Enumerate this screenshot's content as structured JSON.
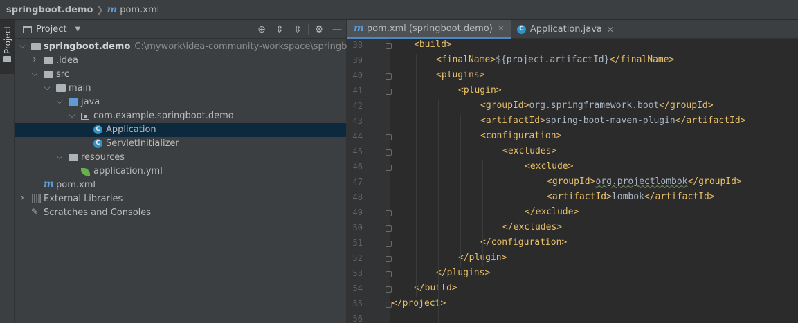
{
  "navbar": {
    "project": "springboot.demo",
    "file": "pom.xml"
  },
  "stripe": {
    "label": "Project"
  },
  "panel": {
    "title": "Project",
    "tree": [
      {
        "label": "springboot.demo",
        "path": "C:\\mywork\\idea-community-workspace\\springboot.demo",
        "depth": 0,
        "icon": "folder",
        "expanded": true,
        "bold": true
      },
      {
        "label": ".idea",
        "depth": 1,
        "icon": "folder",
        "expanded": false
      },
      {
        "label": "src",
        "depth": 1,
        "icon": "folder",
        "expanded": true
      },
      {
        "label": "main",
        "depth": 2,
        "icon": "folder",
        "expanded": true
      },
      {
        "label": "java",
        "depth": 3,
        "icon": "java-folder",
        "expanded": true
      },
      {
        "label": "com.example.springboot.demo",
        "depth": 4,
        "icon": "package",
        "expanded": true
      },
      {
        "label": "Application",
        "depth": 5,
        "icon": "class",
        "selected": true
      },
      {
        "label": "ServletInitializer",
        "depth": 5,
        "icon": "class"
      },
      {
        "label": "resources",
        "depth": 3,
        "icon": "resources-folder",
        "expanded": true
      },
      {
        "label": "application.yml",
        "depth": 4,
        "icon": "spring-config"
      },
      {
        "label": "pom.xml",
        "depth": 1,
        "icon": "maven"
      },
      {
        "label": "External Libraries",
        "depth": 0,
        "icon": "libraries",
        "expanded": false
      },
      {
        "label": "Scratches and Consoles",
        "depth": 0,
        "icon": "scratches"
      }
    ]
  },
  "editor": {
    "tabs": [
      {
        "label": "pom.xml (springboot.demo)",
        "icon": "maven",
        "active": true
      },
      {
        "label": "Application.java",
        "icon": "class",
        "active": false
      }
    ],
    "lines": [
      {
        "no": "38",
        "indent": 1,
        "tag": "<build>",
        "fold": true
      },
      {
        "no": "39",
        "indent": 2,
        "open": "<finalName>",
        "text": "${project.artifactId}",
        "close": "</finalName>"
      },
      {
        "no": "40",
        "indent": 2,
        "tag": "<plugins>",
        "fold": true
      },
      {
        "no": "41",
        "indent": 3,
        "tag": "<plugin>",
        "fold": true
      },
      {
        "no": "42",
        "indent": 4,
        "open": "<groupId>",
        "text": "org.springframework.boot",
        "close": "</groupId>"
      },
      {
        "no": "43",
        "indent": 4,
        "open": "<artifactId>",
        "text": "spring-boot-maven-plugin",
        "close": "</artifactId>"
      },
      {
        "no": "44",
        "indent": 4,
        "tag": "<configuration>",
        "fold": true
      },
      {
        "no": "45",
        "indent": 5,
        "tag": "<excludes>",
        "fold": true
      },
      {
        "no": "46",
        "indent": 6,
        "tag": "<exclude>",
        "fold": true
      },
      {
        "no": "47",
        "indent": 7,
        "open": "<groupId>",
        "text": "org.projectlombok",
        "close": "</groupId>",
        "squiggle": true
      },
      {
        "no": "48",
        "indent": 7,
        "open": "<artifactId>",
        "text": "lombok",
        "close": "</artifactId>"
      },
      {
        "no": "49",
        "indent": 6,
        "tag": "</exclude>",
        "fold": true
      },
      {
        "no": "50",
        "indent": 5,
        "tag": "</excludes>",
        "fold": true
      },
      {
        "no": "51",
        "indent": 4,
        "tag": "</configuration>",
        "fold": true
      },
      {
        "no": "52",
        "indent": 3,
        "tag": "</plugin>",
        "fold": true
      },
      {
        "no": "53",
        "indent": 2,
        "tag": "</plugins>",
        "fold": true
      },
      {
        "no": "54",
        "indent": 1,
        "tag": "</build>",
        "fold": true
      },
      {
        "no": "55",
        "indent": 0,
        "tag": "</project>",
        "fold": true
      },
      {
        "no": "56",
        "indent": 0,
        "tag": ""
      }
    ]
  }
}
